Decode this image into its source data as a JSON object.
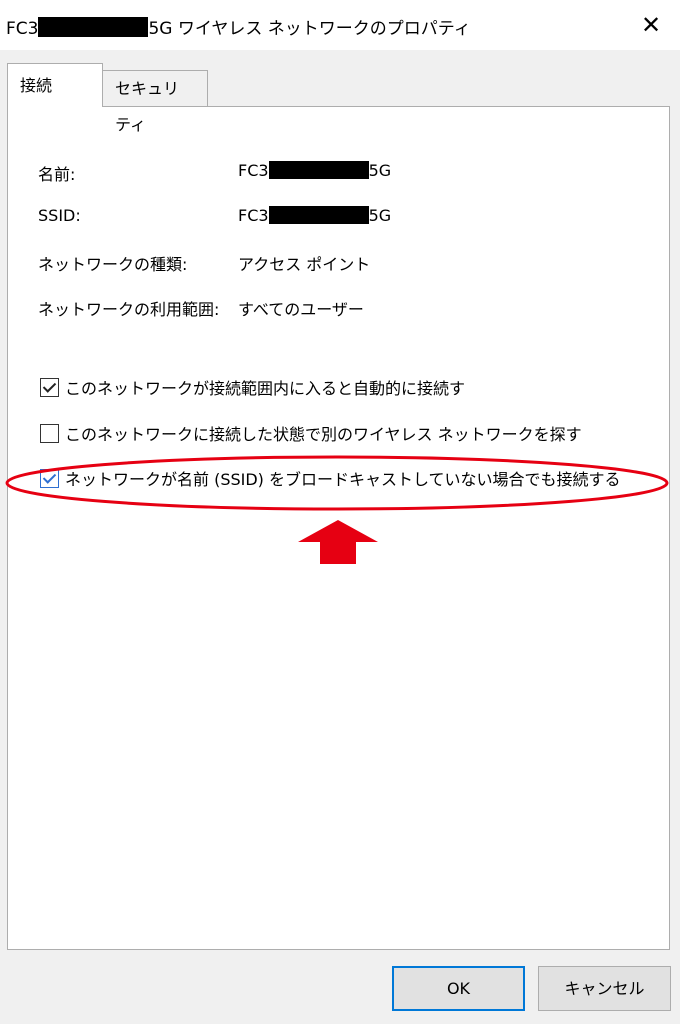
{
  "titlebar": {
    "title_prefix": "FC3",
    "title_suffix": "5G ワイヤレス ネットワークのプロパティ",
    "close_glyph": "✕"
  },
  "tabs": [
    {
      "label": "接続"
    },
    {
      "label": "セキュリティ"
    }
  ],
  "fields": {
    "name": {
      "label": "名前:",
      "value_prefix": "FC3",
      "value_suffix": "5G"
    },
    "ssid": {
      "label": "SSID:",
      "value_prefix": "FC3",
      "value_suffix": "5G"
    },
    "type": {
      "label": "ネットワークの種類:",
      "value": "アクセス ポイント"
    },
    "scope": {
      "label": "ネットワークの利用範囲:",
      "value": "すべてのユーザー"
    }
  },
  "options": [
    {
      "label": "このネットワークが接続範囲内に入ると自動的に接続す",
      "checked": true
    },
    {
      "label": "このネットワークに接続した状態で別のワイヤレス ネットワークを探す",
      "checked": false
    },
    {
      "label": "ネットワークが名前 (SSID) をブロードキャストしていない場合でも接続する",
      "checked": true
    }
  ],
  "buttons": {
    "ok": "OK",
    "cancel": "キャンセル"
  },
  "colors": {
    "annotation_red": "#e60012",
    "focus_blue": "#0078d7"
  },
  "icons": {
    "close": "close-icon",
    "arrow": "arrow-up-icon"
  }
}
